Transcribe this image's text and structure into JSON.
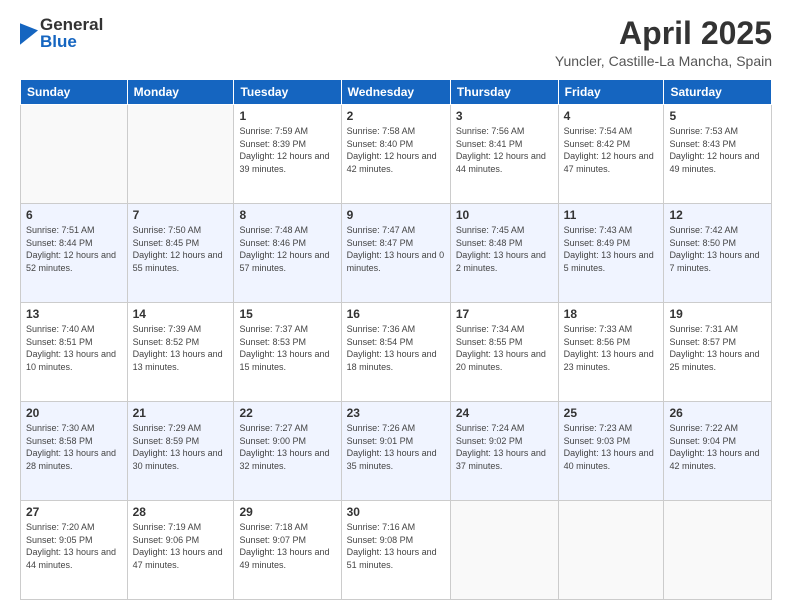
{
  "logo": {
    "general": "General",
    "blue": "Blue"
  },
  "header": {
    "title": "April 2025",
    "subtitle": "Yuncler, Castille-La Mancha, Spain"
  },
  "weekdays": [
    "Sunday",
    "Monday",
    "Tuesday",
    "Wednesday",
    "Thursday",
    "Friday",
    "Saturday"
  ],
  "weeks": [
    [
      {
        "day": "",
        "sunrise": "",
        "sunset": "",
        "daylight": ""
      },
      {
        "day": "",
        "sunrise": "",
        "sunset": "",
        "daylight": ""
      },
      {
        "day": "1",
        "sunrise": "Sunrise: 7:59 AM",
        "sunset": "Sunset: 8:39 PM",
        "daylight": "Daylight: 12 hours and 39 minutes."
      },
      {
        "day": "2",
        "sunrise": "Sunrise: 7:58 AM",
        "sunset": "Sunset: 8:40 PM",
        "daylight": "Daylight: 12 hours and 42 minutes."
      },
      {
        "day": "3",
        "sunrise": "Sunrise: 7:56 AM",
        "sunset": "Sunset: 8:41 PM",
        "daylight": "Daylight: 12 hours and 44 minutes."
      },
      {
        "day": "4",
        "sunrise": "Sunrise: 7:54 AM",
        "sunset": "Sunset: 8:42 PM",
        "daylight": "Daylight: 12 hours and 47 minutes."
      },
      {
        "day": "5",
        "sunrise": "Sunrise: 7:53 AM",
        "sunset": "Sunset: 8:43 PM",
        "daylight": "Daylight: 12 hours and 49 minutes."
      }
    ],
    [
      {
        "day": "6",
        "sunrise": "Sunrise: 7:51 AM",
        "sunset": "Sunset: 8:44 PM",
        "daylight": "Daylight: 12 hours and 52 minutes."
      },
      {
        "day": "7",
        "sunrise": "Sunrise: 7:50 AM",
        "sunset": "Sunset: 8:45 PM",
        "daylight": "Daylight: 12 hours and 55 minutes."
      },
      {
        "day": "8",
        "sunrise": "Sunrise: 7:48 AM",
        "sunset": "Sunset: 8:46 PM",
        "daylight": "Daylight: 12 hours and 57 minutes."
      },
      {
        "day": "9",
        "sunrise": "Sunrise: 7:47 AM",
        "sunset": "Sunset: 8:47 PM",
        "daylight": "Daylight: 13 hours and 0 minutes."
      },
      {
        "day": "10",
        "sunrise": "Sunrise: 7:45 AM",
        "sunset": "Sunset: 8:48 PM",
        "daylight": "Daylight: 13 hours and 2 minutes."
      },
      {
        "day": "11",
        "sunrise": "Sunrise: 7:43 AM",
        "sunset": "Sunset: 8:49 PM",
        "daylight": "Daylight: 13 hours and 5 minutes."
      },
      {
        "day": "12",
        "sunrise": "Sunrise: 7:42 AM",
        "sunset": "Sunset: 8:50 PM",
        "daylight": "Daylight: 13 hours and 7 minutes."
      }
    ],
    [
      {
        "day": "13",
        "sunrise": "Sunrise: 7:40 AM",
        "sunset": "Sunset: 8:51 PM",
        "daylight": "Daylight: 13 hours and 10 minutes."
      },
      {
        "day": "14",
        "sunrise": "Sunrise: 7:39 AM",
        "sunset": "Sunset: 8:52 PM",
        "daylight": "Daylight: 13 hours and 13 minutes."
      },
      {
        "day": "15",
        "sunrise": "Sunrise: 7:37 AM",
        "sunset": "Sunset: 8:53 PM",
        "daylight": "Daylight: 13 hours and 15 minutes."
      },
      {
        "day": "16",
        "sunrise": "Sunrise: 7:36 AM",
        "sunset": "Sunset: 8:54 PM",
        "daylight": "Daylight: 13 hours and 18 minutes."
      },
      {
        "day": "17",
        "sunrise": "Sunrise: 7:34 AM",
        "sunset": "Sunset: 8:55 PM",
        "daylight": "Daylight: 13 hours and 20 minutes."
      },
      {
        "day": "18",
        "sunrise": "Sunrise: 7:33 AM",
        "sunset": "Sunset: 8:56 PM",
        "daylight": "Daylight: 13 hours and 23 minutes."
      },
      {
        "day": "19",
        "sunrise": "Sunrise: 7:31 AM",
        "sunset": "Sunset: 8:57 PM",
        "daylight": "Daylight: 13 hours and 25 minutes."
      }
    ],
    [
      {
        "day": "20",
        "sunrise": "Sunrise: 7:30 AM",
        "sunset": "Sunset: 8:58 PM",
        "daylight": "Daylight: 13 hours and 28 minutes."
      },
      {
        "day": "21",
        "sunrise": "Sunrise: 7:29 AM",
        "sunset": "Sunset: 8:59 PM",
        "daylight": "Daylight: 13 hours and 30 minutes."
      },
      {
        "day": "22",
        "sunrise": "Sunrise: 7:27 AM",
        "sunset": "Sunset: 9:00 PM",
        "daylight": "Daylight: 13 hours and 32 minutes."
      },
      {
        "day": "23",
        "sunrise": "Sunrise: 7:26 AM",
        "sunset": "Sunset: 9:01 PM",
        "daylight": "Daylight: 13 hours and 35 minutes."
      },
      {
        "day": "24",
        "sunrise": "Sunrise: 7:24 AM",
        "sunset": "Sunset: 9:02 PM",
        "daylight": "Daylight: 13 hours and 37 minutes."
      },
      {
        "day": "25",
        "sunrise": "Sunrise: 7:23 AM",
        "sunset": "Sunset: 9:03 PM",
        "daylight": "Daylight: 13 hours and 40 minutes."
      },
      {
        "day": "26",
        "sunrise": "Sunrise: 7:22 AM",
        "sunset": "Sunset: 9:04 PM",
        "daylight": "Daylight: 13 hours and 42 minutes."
      }
    ],
    [
      {
        "day": "27",
        "sunrise": "Sunrise: 7:20 AM",
        "sunset": "Sunset: 9:05 PM",
        "daylight": "Daylight: 13 hours and 44 minutes."
      },
      {
        "day": "28",
        "sunrise": "Sunrise: 7:19 AM",
        "sunset": "Sunset: 9:06 PM",
        "daylight": "Daylight: 13 hours and 47 minutes."
      },
      {
        "day": "29",
        "sunrise": "Sunrise: 7:18 AM",
        "sunset": "Sunset: 9:07 PM",
        "daylight": "Daylight: 13 hours and 49 minutes."
      },
      {
        "day": "30",
        "sunrise": "Sunrise: 7:16 AM",
        "sunset": "Sunset: 9:08 PM",
        "daylight": "Daylight: 13 hours and 51 minutes."
      },
      {
        "day": "",
        "sunrise": "",
        "sunset": "",
        "daylight": ""
      },
      {
        "day": "",
        "sunrise": "",
        "sunset": "",
        "daylight": ""
      },
      {
        "day": "",
        "sunrise": "",
        "sunset": "",
        "daylight": ""
      }
    ]
  ]
}
